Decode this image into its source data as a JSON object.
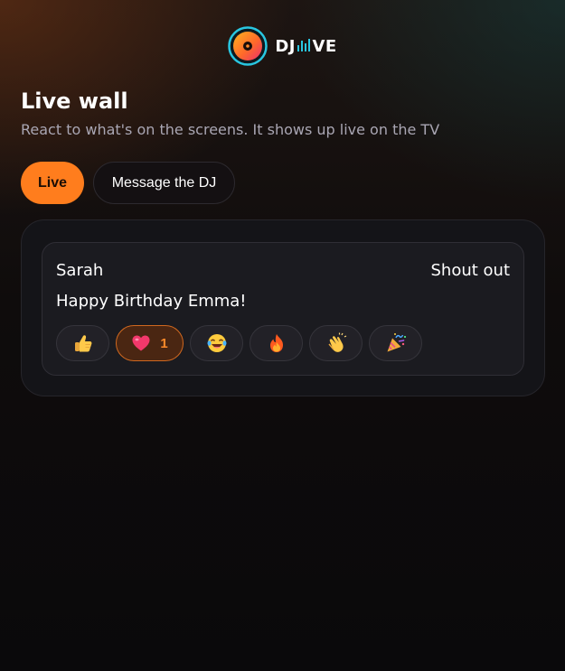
{
  "brand": {
    "name_left": "DJ",
    "name_right": "VE"
  },
  "page": {
    "title": "Live wall",
    "subtitle": "React to what's on the screens. It shows up live on the TV"
  },
  "tabs": [
    {
      "label": "Live",
      "active": true
    },
    {
      "label": "Message the DJ",
      "active": false
    }
  ],
  "feed": [
    {
      "author": "Sarah",
      "type": "Shout out",
      "message": "Happy Birthday Emma!",
      "reactions": [
        {
          "icon": "thumbs-up-icon",
          "count": null,
          "active": false
        },
        {
          "icon": "heart-icon",
          "count": "1",
          "active": true
        },
        {
          "icon": "laughing-face-icon",
          "count": null,
          "active": false
        },
        {
          "icon": "fire-icon",
          "count": null,
          "active": false
        },
        {
          "icon": "clapping-hands-icon",
          "count": null,
          "active": false
        },
        {
          "icon": "party-popper-icon",
          "count": null,
          "active": false
        }
      ]
    }
  ],
  "colors": {
    "accent": "#ff7d1d",
    "background": "#0c0a0b",
    "card": "#1b1b20",
    "logo_ring": "#29c6e0"
  }
}
